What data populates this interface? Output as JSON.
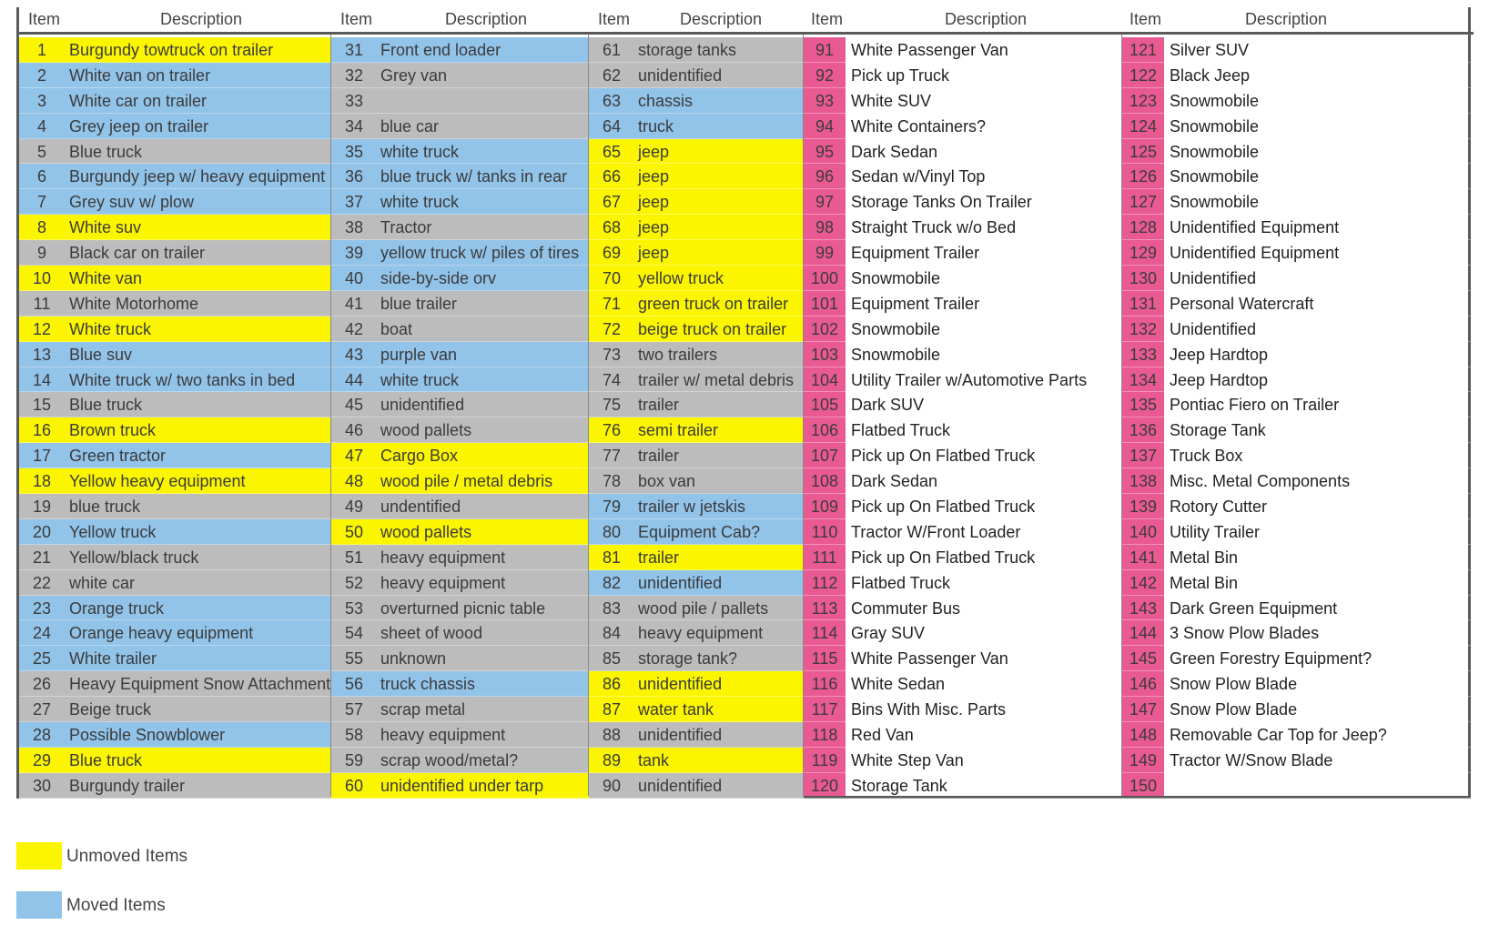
{
  "headers": {
    "item": "Item",
    "description": "Description"
  },
  "colors": {
    "unmoved": "#fbf600",
    "moved": "#92c3e9",
    "other": "#bcbcbc",
    "highlight": "#ea5a92"
  },
  "columns": [
    {
      "rows": [
        {
          "n": "1",
          "d": "Burgundy towtruck on trailer",
          "c": "yellow"
        },
        {
          "n": "2",
          "d": "White van on trailer",
          "c": "blue"
        },
        {
          "n": "3",
          "d": "White car on trailer",
          "c": "blue"
        },
        {
          "n": "4",
          "d": "Grey jeep on trailer",
          "c": "blue"
        },
        {
          "n": "5",
          "d": "Blue truck",
          "c": "gray"
        },
        {
          "n": "6",
          "d": "Burgundy jeep w/ heavy equipment",
          "c": "blue"
        },
        {
          "n": "7",
          "d": "Grey suv w/ plow",
          "c": "blue"
        },
        {
          "n": "8",
          "d": "White suv",
          "c": "yellow"
        },
        {
          "n": "9",
          "d": "Black car on trailer",
          "c": "gray"
        },
        {
          "n": "10",
          "d": "White van",
          "c": "yellow"
        },
        {
          "n": "11",
          "d": "White Motorhome",
          "c": "gray"
        },
        {
          "n": "12",
          "d": "White truck",
          "c": "yellow"
        },
        {
          "n": "13",
          "d": "Blue suv",
          "c": "blue"
        },
        {
          "n": "14",
          "d": "White truck w/ two tanks in bed",
          "c": "blue"
        },
        {
          "n": "15",
          "d": "Blue truck",
          "c": "gray"
        },
        {
          "n": "16",
          "d": "Brown truck",
          "c": "yellow"
        },
        {
          "n": "17",
          "d": "Green tractor",
          "c": "blue"
        },
        {
          "n": "18",
          "d": "Yellow heavy equipment",
          "c": "yellow"
        },
        {
          "n": "19",
          "d": "blue truck",
          "c": "gray"
        },
        {
          "n": "20",
          "d": "Yellow truck",
          "c": "blue"
        },
        {
          "n": "21",
          "d": "Yellow/black truck",
          "c": "gray"
        },
        {
          "n": "22",
          "d": "white car",
          "c": "gray"
        },
        {
          "n": "23",
          "d": "Orange truck",
          "c": "blue"
        },
        {
          "n": "24",
          "d": "Orange heavy equipment",
          "c": "blue"
        },
        {
          "n": "25",
          "d": "White trailer",
          "c": "blue"
        },
        {
          "n": "26",
          "d": "Heavy Equipment Snow Attachment",
          "c": "gray"
        },
        {
          "n": "27",
          "d": "Beige truck",
          "c": "gray"
        },
        {
          "n": "28",
          "d": "Possible Snowblower",
          "c": "blue"
        },
        {
          "n": "29",
          "d": "Blue truck",
          "c": "yellow"
        },
        {
          "n": "30",
          "d": "Burgundy trailer",
          "c": "gray"
        }
      ]
    },
    {
      "rows": [
        {
          "n": "31",
          "d": "Front end loader",
          "c": "blue"
        },
        {
          "n": "32",
          "d": "Grey van",
          "c": "gray"
        },
        {
          "n": "33",
          "d": "",
          "c": "gray"
        },
        {
          "n": "34",
          "d": "blue car",
          "c": "gray"
        },
        {
          "n": "35",
          "d": "white truck",
          "c": "blue"
        },
        {
          "n": "36",
          "d": "blue truck w/ tanks in rear",
          "c": "blue"
        },
        {
          "n": "37",
          "d": "white truck",
          "c": "blue"
        },
        {
          "n": "38",
          "d": "Tractor",
          "c": "gray"
        },
        {
          "n": "39",
          "d": "yellow truck w/ piles of tires",
          "c": "blue"
        },
        {
          "n": "40",
          "d": "side-by-side orv",
          "c": "blue"
        },
        {
          "n": "41",
          "d": "blue trailer",
          "c": "gray"
        },
        {
          "n": "42",
          "d": "boat",
          "c": "gray"
        },
        {
          "n": "43",
          "d": "purple van",
          "c": "blue"
        },
        {
          "n": "44",
          "d": "white truck",
          "c": "blue"
        },
        {
          "n": "45",
          "d": "unidentified",
          "c": "gray"
        },
        {
          "n": "46",
          "d": "wood pallets",
          "c": "gray"
        },
        {
          "n": "47",
          "d": "Cargo Box",
          "c": "yellow"
        },
        {
          "n": "48",
          "d": "wood pile / metal debris",
          "c": "yellow"
        },
        {
          "n": "49",
          "d": "undentified",
          "c": "gray"
        },
        {
          "n": "50",
          "d": "wood pallets",
          "c": "yellow"
        },
        {
          "n": "51",
          "d": "heavy equipment",
          "c": "gray"
        },
        {
          "n": "52",
          "d": "heavy equipment",
          "c": "gray"
        },
        {
          "n": "53",
          "d": "overturned picnic table",
          "c": "gray"
        },
        {
          "n": "54",
          "d": "sheet of wood",
          "c": "gray"
        },
        {
          "n": "55",
          "d": "unknown",
          "c": "gray"
        },
        {
          "n": "56",
          "d": "truck chassis",
          "c": "blue"
        },
        {
          "n": "57",
          "d": "scrap metal",
          "c": "gray"
        },
        {
          "n": "58",
          "d": "heavy equipment",
          "c": "gray"
        },
        {
          "n": "59",
          "d": "scrap wood/metal?",
          "c": "gray"
        },
        {
          "n": "60",
          "d": "unidentified under tarp",
          "c": "yellow"
        }
      ]
    },
    {
      "rows": [
        {
          "n": "61",
          "d": "storage tanks",
          "c": "gray"
        },
        {
          "n": "62",
          "d": "unidentified",
          "c": "gray"
        },
        {
          "n": "63",
          "d": "chassis",
          "c": "blue"
        },
        {
          "n": "64",
          "d": "truck",
          "c": "blue"
        },
        {
          "n": "65",
          "d": "jeep",
          "c": "yellow"
        },
        {
          "n": "66",
          "d": "jeep",
          "c": "yellow"
        },
        {
          "n": "67",
          "d": "jeep",
          "c": "yellow"
        },
        {
          "n": "68",
          "d": "jeep",
          "c": "yellow"
        },
        {
          "n": "69",
          "d": "jeep",
          "c": "yellow"
        },
        {
          "n": "70",
          "d": "yellow truck",
          "c": "yellow"
        },
        {
          "n": "71",
          "d": "green truck on trailer",
          "c": "yellow"
        },
        {
          "n": "72",
          "d": "beige truck on trailer",
          "c": "yellow"
        },
        {
          "n": "73",
          "d": "two trailers",
          "c": "gray"
        },
        {
          "n": "74",
          "d": "trailer w/ metal debris",
          "c": "gray"
        },
        {
          "n": "75",
          "d": "trailer",
          "c": "gray"
        },
        {
          "n": "76",
          "d": "semi trailer",
          "c": "yellow"
        },
        {
          "n": "77",
          "d": "trailer",
          "c": "gray"
        },
        {
          "n": "78",
          "d": "box van",
          "c": "gray"
        },
        {
          "n": "79",
          "d": "trailer w jetskis",
          "c": "blue"
        },
        {
          "n": "80",
          "d": "Equipment Cab?",
          "c": "blue"
        },
        {
          "n": "81",
          "d": "trailer",
          "c": "yellow"
        },
        {
          "n": "82",
          "d": "unidentified",
          "c": "blue"
        },
        {
          "n": "83",
          "d": "wood pile / pallets",
          "c": "gray"
        },
        {
          "n": "84",
          "d": "heavy equipment",
          "c": "gray"
        },
        {
          "n": "85",
          "d": "storage tank?",
          "c": "gray"
        },
        {
          "n": "86",
          "d": "unidentified",
          "c": "yellow"
        },
        {
          "n": "87",
          "d": "water tank",
          "c": "yellow"
        },
        {
          "n": "88",
          "d": "unidentified",
          "c": "gray"
        },
        {
          "n": "89",
          "d": "tank",
          "c": "yellow"
        },
        {
          "n": "90",
          "d": "unidentified",
          "c": "gray"
        }
      ]
    },
    {
      "rows": [
        {
          "n": "91",
          "d": "White Passenger Van",
          "c": "white"
        },
        {
          "n": "92",
          "d": "Pick up Truck",
          "c": "white"
        },
        {
          "n": "93",
          "d": "White SUV",
          "c": "white"
        },
        {
          "n": "94",
          "d": "White Containers?",
          "c": "white"
        },
        {
          "n": "95",
          "d": "Dark Sedan",
          "c": "white"
        },
        {
          "n": "96",
          "d": "Sedan w/Vinyl Top",
          "c": "white"
        },
        {
          "n": "97",
          "d": "Storage Tanks On Trailer",
          "c": "white"
        },
        {
          "n": "98",
          "d": "Straight Truck w/o Bed",
          "c": "white"
        },
        {
          "n": "99",
          "d": "Equipment Trailer",
          "c": "white"
        },
        {
          "n": "100",
          "d": "Snowmobile",
          "c": "white"
        },
        {
          "n": "101",
          "d": "Equipment Trailer",
          "c": "white"
        },
        {
          "n": "102",
          "d": "Snowmobile",
          "c": "white"
        },
        {
          "n": "103",
          "d": "Snowmobile",
          "c": "white"
        },
        {
          "n": "104",
          "d": "Utility Trailer w/Automotive Parts",
          "c": "white"
        },
        {
          "n": "105",
          "d": "Dark SUV",
          "c": "white"
        },
        {
          "n": "106",
          "d": "Flatbed Truck",
          "c": "white"
        },
        {
          "n": "107",
          "d": "Pick up On Flatbed Truck",
          "c": "white"
        },
        {
          "n": "108",
          "d": "Dark Sedan",
          "c": "white"
        },
        {
          "n": "109",
          "d": "Pick up On Flatbed Truck",
          "c": "white"
        },
        {
          "n": "110",
          "d": "Tractor W/Front Loader",
          "c": "white"
        },
        {
          "n": "111",
          "d": "Pick up On Flatbed Truck",
          "c": "white"
        },
        {
          "n": "112",
          "d": "Flatbed Truck",
          "c": "white"
        },
        {
          "n": "113",
          "d": "Commuter Bus",
          "c": "white"
        },
        {
          "n": "114",
          "d": "Gray SUV",
          "c": "white"
        },
        {
          "n": "115",
          "d": "White Passenger Van",
          "c": "white"
        },
        {
          "n": "116",
          "d": "White Sedan",
          "c": "white"
        },
        {
          "n": "117",
          "d": "Bins With Misc. Parts",
          "c": "white"
        },
        {
          "n": "118",
          "d": "Red Van",
          "c": "white"
        },
        {
          "n": "119",
          "d": "White Step Van",
          "c": "white"
        },
        {
          "n": "120",
          "d": "Storage Tank",
          "c": "white"
        }
      ]
    },
    {
      "rows": [
        {
          "n": "121",
          "d": "Silver SUV",
          "c": "white"
        },
        {
          "n": "122",
          "d": "Black Jeep",
          "c": "white"
        },
        {
          "n": "123",
          "d": "Snowmobile",
          "c": "white"
        },
        {
          "n": "124",
          "d": "Snowmobile",
          "c": "white"
        },
        {
          "n": "125",
          "d": "Snowmobile",
          "c": "white"
        },
        {
          "n": "126",
          "d": "Snowmobile",
          "c": "white"
        },
        {
          "n": "127",
          "d": "Snowmobile",
          "c": "white"
        },
        {
          "n": "128",
          "d": "Unidentified Equipment",
          "c": "white"
        },
        {
          "n": "129",
          "d": "Unidentified Equipment",
          "c": "white"
        },
        {
          "n": "130",
          "d": "Unidentified",
          "c": "white"
        },
        {
          "n": "131",
          "d": "Personal Watercraft",
          "c": "white"
        },
        {
          "n": "132",
          "d": "Unidentified",
          "c": "white"
        },
        {
          "n": "133",
          "d": "Jeep Hardtop",
          "c": "white"
        },
        {
          "n": "134",
          "d": "Jeep Hardtop",
          "c": "white"
        },
        {
          "n": "135",
          "d": "Pontiac Fiero on Trailer",
          "c": "white"
        },
        {
          "n": "136",
          "d": "Storage Tank",
          "c": "white"
        },
        {
          "n": "137",
          "d": "Truck Box",
          "c": "white"
        },
        {
          "n": "138",
          "d": "Misc. Metal Components",
          "c": "white"
        },
        {
          "n": "139",
          "d": "Rotory Cutter",
          "c": "white"
        },
        {
          "n": "140",
          "d": "Utility Trailer",
          "c": "white"
        },
        {
          "n": "141",
          "d": "Metal Bin",
          "c": "white"
        },
        {
          "n": "142",
          "d": "Metal Bin",
          "c": "white"
        },
        {
          "n": "143",
          "d": "Dark Green Equipment",
          "c": "white"
        },
        {
          "n": "144",
          "d": "3 Snow Plow Blades",
          "c": "white"
        },
        {
          "n": "145",
          "d": "Green Forestry Equipment?",
          "c": "white"
        },
        {
          "n": "146",
          "d": "Snow Plow Blade",
          "c": "white"
        },
        {
          "n": "147",
          "d": "Snow Plow Blade",
          "c": "white"
        },
        {
          "n": "148",
          "d": "Removable Car Top for Jeep?",
          "c": "white"
        },
        {
          "n": "149",
          "d": "Tractor W/Snow Blade",
          "c": "white"
        },
        {
          "n": "150",
          "d": "",
          "c": "white"
        }
      ]
    }
  ],
  "legend": [
    {
      "label": "Unmoved Items",
      "color": "yellow"
    },
    {
      "label": "Moved Items",
      "color": "blue"
    }
  ]
}
